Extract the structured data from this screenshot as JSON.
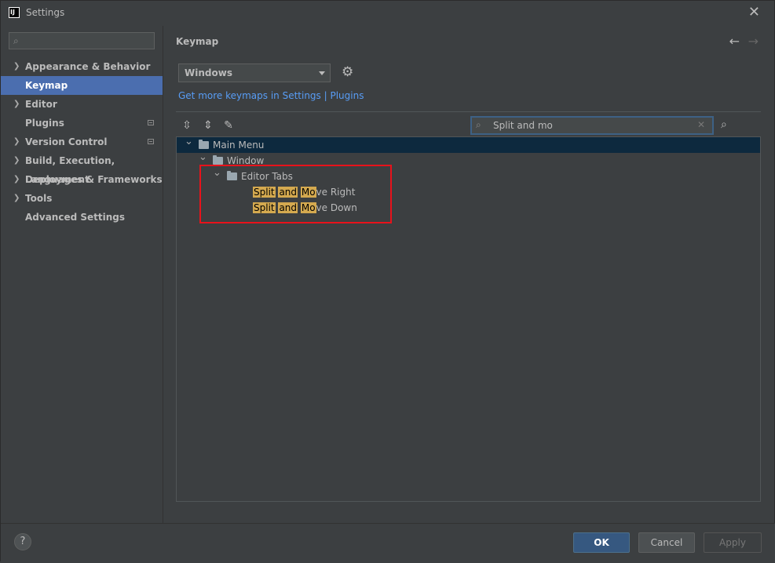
{
  "window": {
    "title": "Settings",
    "app_icon": "intellij-icon",
    "close_glyph": "✕"
  },
  "sidebar": {
    "search": {
      "value": "",
      "icon": "search-icon"
    },
    "items": [
      {
        "label": "Appearance & Behavior",
        "expandable": true,
        "badge": false,
        "selected": false
      },
      {
        "label": "Keymap",
        "expandable": false,
        "badge": false,
        "selected": true
      },
      {
        "label": "Editor",
        "expandable": true,
        "badge": false,
        "selected": false
      },
      {
        "label": "Plugins",
        "expandable": false,
        "badge": true,
        "selected": false
      },
      {
        "label": "Version Control",
        "expandable": true,
        "badge": true,
        "selected": false
      },
      {
        "label": "Build, Execution, Deployment",
        "expandable": true,
        "badge": false,
        "selected": false
      },
      {
        "label": "Languages & Frameworks",
        "expandable": true,
        "badge": false,
        "selected": false
      },
      {
        "label": "Tools",
        "expandable": true,
        "badge": false,
        "selected": false
      },
      {
        "label": "Advanced Settings",
        "expandable": false,
        "badge": false,
        "selected": false
      }
    ]
  },
  "main": {
    "title": "Keymap",
    "keymap_select": {
      "value": "Windows"
    },
    "get_more_link": "Get more keymaps in Settings | Plugins",
    "filter": {
      "value": "Split and mo"
    },
    "tree": [
      {
        "label": "Main Menu",
        "level": 0,
        "expanded": true,
        "type": "menu-folder",
        "selected": true
      },
      {
        "label": "Window",
        "level": 1,
        "expanded": true,
        "type": "folder",
        "selected": false
      },
      {
        "label": "Editor Tabs",
        "level": 2,
        "expanded": true,
        "type": "folder",
        "selected": false
      },
      {
        "label": "Split and Move Right",
        "level": 3,
        "type": "action",
        "match_parts": [
          "Split",
          " ",
          "and",
          " ",
          "Mo",
          "ve Right"
        ]
      },
      {
        "label": "Split and Move Down",
        "level": 3,
        "type": "action",
        "match_parts": [
          "Split",
          " ",
          "and",
          " ",
          "Mo",
          "ve Down"
        ]
      }
    ]
  },
  "footer": {
    "help_label": "?",
    "ok_label": "OK",
    "cancel_label": "Cancel",
    "apply_label": "Apply"
  },
  "colors": {
    "background": "#3c3f41",
    "selection": "#4b6eaf",
    "tree_selection": "#0d293e",
    "link": "#589df6",
    "match_highlight": "#d4a94f",
    "annotation_border": "#e8121b"
  }
}
